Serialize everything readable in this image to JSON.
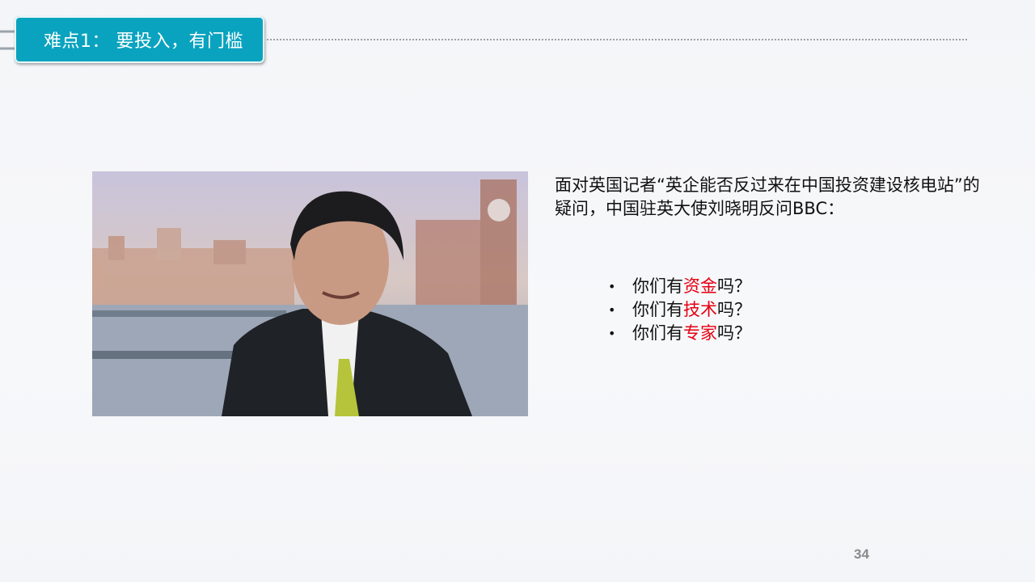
{
  "title": "难点1：  要投入，有门槛",
  "quote": "面对英国记者“英企能否反过来在中国投资建设核电站”的疑问，中国驻英大使刘晓明反问BBC：",
  "questions": [
    {
      "prefix": "你们有",
      "highlight": "资金",
      "suffix": "吗？"
    },
    {
      "prefix": "你们有",
      "highlight": "技术",
      "suffix": "吗？"
    },
    {
      "prefix": "你们有",
      "highlight": "专家",
      "suffix": "吗？"
    }
  ],
  "bullet_symbol": "•",
  "page_number": "34",
  "colors": {
    "accent": "#0aa3bf",
    "highlight": "#e60012"
  }
}
